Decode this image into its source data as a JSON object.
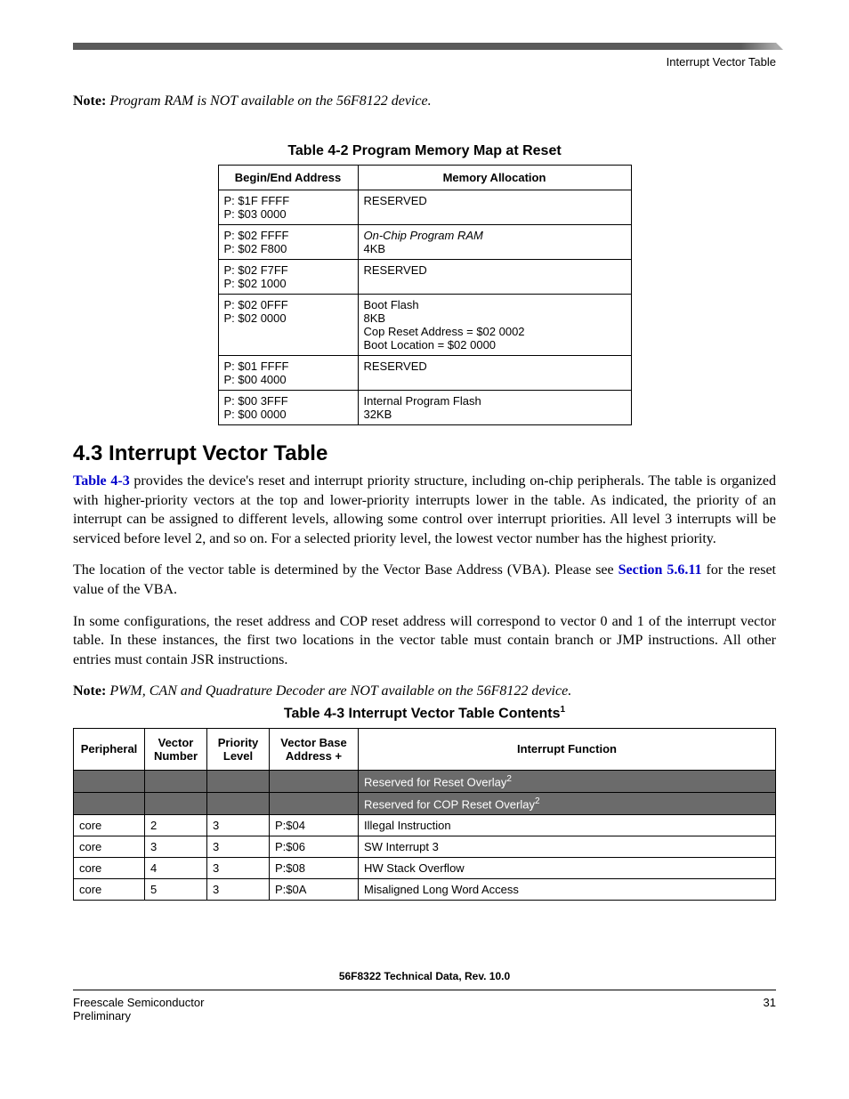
{
  "header": {
    "right": "Interrupt Vector Table"
  },
  "note1": {
    "label": "Note:",
    "text": "Program RAM is NOT available on the 56F8122 device."
  },
  "table42": {
    "title": "Table 4-2 Program Memory Map at Reset",
    "headers": {
      "c1": "Begin/End Address",
      "c2": "Memory Allocation"
    },
    "rows": [
      {
        "c1a": "P: $1F FFFF",
        "c1b": "P: $03 0000",
        "c2a": "RESERVED"
      },
      {
        "c1a": "P: $02 FFFF",
        "c1b": "P: $02 F800",
        "c2a_ital": "On-Chip Program RAM",
        "c2b": "4KB"
      },
      {
        "c1a": "P: $02 F7FF",
        "c1b": "P: $02 1000",
        "c2a": "RESERVED"
      },
      {
        "c1a": "P: $02 0FFF",
        "c1b": "P: $02 0000",
        "c2a": "Boot Flash",
        "c2b": "8KB",
        "c2c": "Cop Reset Address = $02 0002",
        "c2d": "Boot Location = $02 0000"
      },
      {
        "c1a": "P: $01 FFFF",
        "c1b": "P: $00 4000",
        "c2a": "RESERVED"
      },
      {
        "c1a": "P: $00 3FFF",
        "c1b": "P: $00 0000",
        "c2a": "Internal Program Flash",
        "c2b": "32KB"
      }
    ]
  },
  "section": {
    "heading": "4.3   Interrupt Vector Table",
    "para1_link": "Table 4-3",
    "para1_rest": " provides the device's reset and interrupt priority structure, including on-chip peripherals. The table is organized with higher-priority vectors at the top and lower-priority interrupts lower in the table. As indicated, the priority of an interrupt can be assigned to different levels, allowing some control over interrupt priorities. All level 3 interrupts will be serviced before level 2, and so on. For a selected priority level, the lowest vector number has the highest priority.",
    "para2_a": "The location of the vector table is determined by the Vector Base Address (VBA). Please see ",
    "para2_link": "Section 5.6.11",
    "para2_b": "  for the reset value of the VBA.",
    "para3": "In some configurations, the reset address and COP reset address will correspond to vector 0 and 1 of the interrupt vector table. In these instances, the first two locations in the vector table must contain branch or JMP instructions. All other entries must contain JSR instructions."
  },
  "note2": {
    "label": "Note:",
    "text": "PWM, CAN and Quadrature Decoder are NOT available on the 56F8122 device."
  },
  "table43": {
    "title_a": "Table 4-3 Interrupt Vector Table Contents",
    "title_sup": "1",
    "headers": {
      "c1": "Peripheral",
      "c2": "Vector Number",
      "c3": "Priority Level",
      "c4": "Vector Base Address +",
      "c5": "Interrupt Function"
    },
    "rows": [
      {
        "shaded": true,
        "c1": "",
        "c2": "",
        "c3": "",
        "c4": "",
        "c5": "Reserved for Reset Overlay",
        "c5sup": "2"
      },
      {
        "shaded": true,
        "c1": "",
        "c2": "",
        "c3": "",
        "c4": "",
        "c5": "Reserved for COP Reset Overlay",
        "c5sup": "2"
      },
      {
        "c1": "core",
        "c2": "2",
        "c3": "3",
        "c4": "P:$04",
        "c5": "Illegal Instruction"
      },
      {
        "c1": "core",
        "c2": "3",
        "c3": "3",
        "c4": "P:$06",
        "c5": "SW Interrupt 3"
      },
      {
        "c1": "core",
        "c2": "4",
        "c3": "3",
        "c4": "P:$08",
        "c5": "HW Stack Overflow"
      },
      {
        "c1": "core",
        "c2": "5",
        "c3": "3",
        "c4": "P:$0A",
        "c5": "Misaligned Long Word Access"
      }
    ]
  },
  "footer": {
    "docref": "56F8322 Technical Data, Rev. 10.0",
    "left1": "Freescale Semiconductor",
    "left2": "Preliminary",
    "right": "31"
  }
}
